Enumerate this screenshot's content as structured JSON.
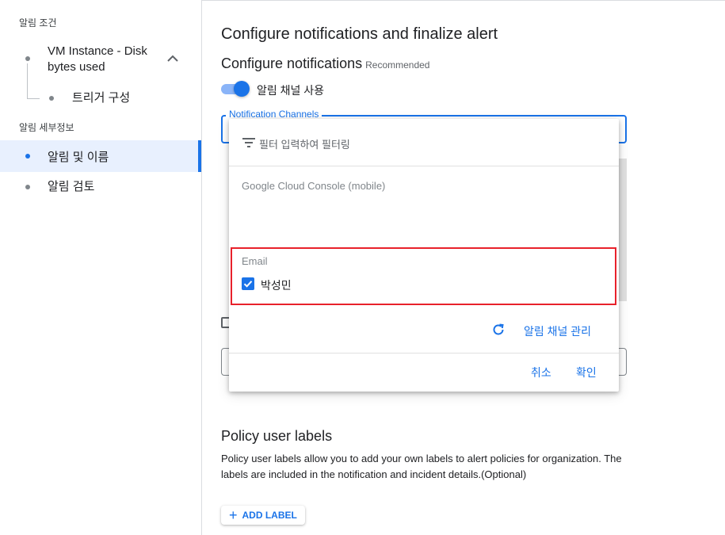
{
  "sidebar": {
    "section_conditions": "알림 조건",
    "condition_item": "VM Instance - Disk bytes used",
    "trigger_item": "트리거 구성",
    "section_details": "알림 세부정보",
    "active_item": "알림 및 이름",
    "review_item": "알림 검토"
  },
  "main": {
    "title": "Configure notifications and finalize alert",
    "subtitle": "Configure notifications",
    "recommended": "Recommended",
    "toggle_label": "알림 채널 사용",
    "field_label": "Notification Channels",
    "toggle_on": true
  },
  "dropdown": {
    "filter_placeholder": "필터 입력하여 필터링",
    "group_mobile": "Google Cloud Console (mobile)",
    "group_email": "Email",
    "email_option": "박성민",
    "email_checked": true,
    "manage_link": "알림 채널 관리",
    "cancel": "취소",
    "ok": "확인"
  },
  "labels_section": {
    "title": "Policy user labels",
    "description": "Policy user labels allow you to add your own labels to alert policies for organization. The labels are included in the notification and incident details.(Optional)",
    "add_label": "ADD LABEL"
  },
  "colors": {
    "accent": "#1a73e8",
    "highlight_box": "#e8212b",
    "active_bg": "#e8f0fe"
  }
}
